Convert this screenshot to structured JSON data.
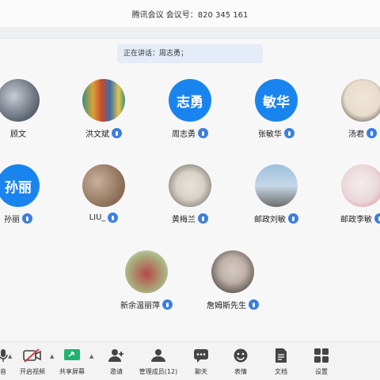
{
  "window": {
    "title": "腾讯会议 会议号：820 345 161"
  },
  "speaking": {
    "text": "正在讲话：周志勇；"
  },
  "participants": [
    {
      "name": "顾文",
      "avatar_text": "",
      "avatar_kind": "photo",
      "colors": [
        "#5b6470",
        "#c8cdd5"
      ],
      "mic": false
    },
    {
      "name": "洪文斌",
      "avatar_text": "",
      "avatar_kind": "photo",
      "colors": [
        "#d9a23a",
        "#3f8f7a"
      ],
      "mic": true
    },
    {
      "name": "周志勇",
      "avatar_text": "志勇",
      "avatar_kind": "text",
      "mic": true
    },
    {
      "name": "张敏华",
      "avatar_text": "敏华",
      "avatar_kind": "text",
      "mic": true
    },
    {
      "name": "汤君",
      "avatar_text": "",
      "avatar_kind": "photo",
      "colors": [
        "#f0e6d6",
        "#2b2b2b"
      ],
      "mic": true
    },
    {
      "name": "孙丽",
      "avatar_text": "孙丽",
      "avatar_kind": "text",
      "mic": true
    },
    {
      "name": "LIU_",
      "avatar_text": "",
      "avatar_kind": "photo",
      "colors": [
        "#8a6c56",
        "#c9b29c"
      ],
      "mic": true
    },
    {
      "name": "黄梅兰",
      "avatar_text": "",
      "avatar_kind": "photo",
      "colors": [
        "#d9d2c8",
        "#5e5a55"
      ],
      "mic": true
    },
    {
      "name": "邮政刘敏",
      "avatar_text": "",
      "avatar_kind": "photo",
      "colors": [
        "#9bbfdd",
        "#6d6d6d"
      ],
      "mic": true
    },
    {
      "name": "邮政李敏",
      "avatar_text": "",
      "avatar_kind": "photo",
      "colors": [
        "#f4eeee",
        "#d77f8f"
      ],
      "mic": true
    },
    {
      "name": "新余温丽萍",
      "avatar_text": "",
      "avatar_kind": "photo",
      "colors": [
        "#a9b07d",
        "#b44a4a"
      ],
      "mic": true
    },
    {
      "name": "詹姆斯先生",
      "avatar_text": "",
      "avatar_kind": "photo",
      "colors": [
        "#d5cbc3",
        "#2d2724"
      ],
      "mic": true
    }
  ],
  "toolbar": {
    "items": [
      {
        "label": "音",
        "icon": "mic-icon"
      },
      {
        "label": "开启视频",
        "icon": "camera-off-icon"
      },
      {
        "label": "共享屏幕",
        "icon": "share-screen-icon"
      },
      {
        "label": "邀请",
        "icon": "invite-icon"
      },
      {
        "label": "管理成员(12)",
        "icon": "members-icon"
      },
      {
        "label": "聊天",
        "icon": "chat-icon"
      },
      {
        "label": "表情",
        "icon": "emoji-icon"
      },
      {
        "label": "文档",
        "icon": "document-icon"
      },
      {
        "label": "设置",
        "icon": "settings-icon"
      }
    ]
  },
  "colors": {
    "accent": "#1a84ee",
    "mic": "#3a7ee0",
    "share_green": "#1fb36b",
    "camera_red": "#d7373f"
  }
}
